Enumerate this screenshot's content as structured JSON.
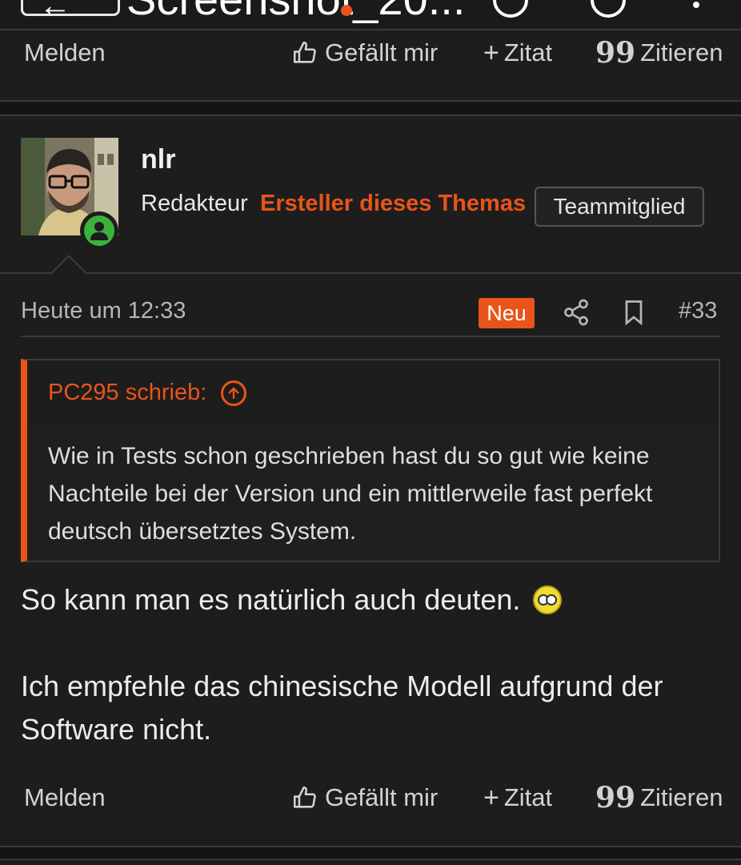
{
  "topbar": {
    "title": "Screenshot_20..."
  },
  "actions_top": {
    "report": "Melden",
    "like": "Gefällt mir",
    "quote_add": "Zitat",
    "reply_quote": "Zitieren"
  },
  "post": {
    "username": "nlr",
    "role": "Redakteur",
    "starter_label": "Ersteller dieses Themas",
    "team_badge": "Teammitglied",
    "time": "Heute um 12:33",
    "new_badge": "Neu",
    "post_number": "#33",
    "quote": {
      "author": "PC295 schrieb:",
      "text": "Wie in Tests schon geschrieben hast du so gut wie keine Nachteile bei der Version und ein mittlerweile fast perfekt deutsch übersetztes System."
    },
    "paragraph1": "So kann man es natürlich auch deuten.",
    "paragraph2": "Ich empfehle das chinesische Modell aufgrund der Software nicht."
  },
  "actions_bottom": {
    "report": "Melden",
    "like": "Gefällt mir",
    "quote_add": "Zitat",
    "reply_quote": "Zitieren"
  },
  "colors": {
    "accent": "#e8541a",
    "online": "#3bb23b",
    "background": "#1d1d1d"
  }
}
